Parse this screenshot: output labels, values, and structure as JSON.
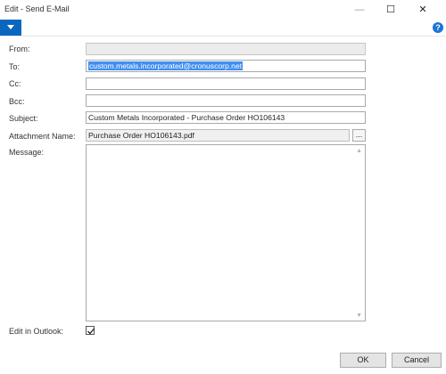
{
  "window": {
    "title": "Edit - Send E-Mail",
    "minimize": "—",
    "maximize": "☐",
    "close": "✕"
  },
  "actionbar": {
    "help": "?"
  },
  "form": {
    "from_label": "From:",
    "from_value": "",
    "to_label": "To:",
    "to_value": "custom.metals.incorporated@cronuscorp.net",
    "cc_label": "Cc:",
    "cc_value": "",
    "bcc_label": "Bcc:",
    "bcc_value": "",
    "subject_label": "Subject:",
    "subject_value": "Custom Metals Incorporated - Purchase Order HO106143",
    "attachment_label": "Attachment Name:",
    "attachment_value": "Purchase Order HO106143.pdf",
    "attachment_button": "...",
    "message_label": "Message:",
    "message_value": "",
    "edit_in_outlook_label": "Edit in Outlook:",
    "edit_in_outlook_checked": true
  },
  "buttons": {
    "ok": "OK",
    "cancel": "Cancel"
  },
  "colors": {
    "accent": "#0a67c0",
    "selection": "#3f8ef0",
    "help": "#1a73d8"
  }
}
